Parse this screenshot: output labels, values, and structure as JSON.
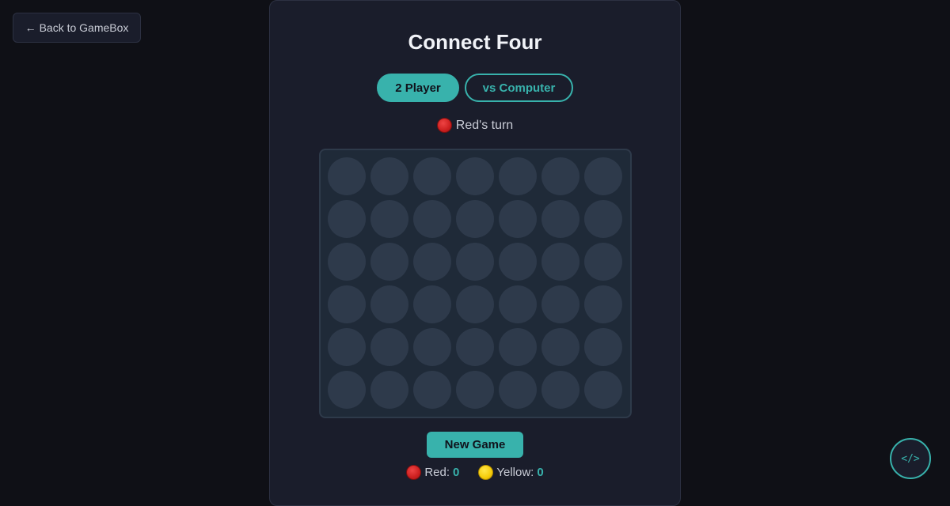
{
  "nav": {
    "back_arrow": "←",
    "back_label": "Back to GameBox"
  },
  "game": {
    "title": "Connect Four",
    "modes": [
      {
        "label": "2 Player",
        "active": true
      },
      {
        "label": "vs Computer",
        "active": false
      }
    ],
    "status_text": "Red's turn",
    "status_disc": "red",
    "board": {
      "rows": 6,
      "columns": 7,
      "cells": [
        [
          "",
          "",
          "",
          "",
          "",
          "",
          ""
        ],
        [
          "",
          "",
          "",
          "",
          "",
          "",
          ""
        ],
        [
          "",
          "",
          "",
          "",
          "",
          "",
          ""
        ],
        [
          "",
          "",
          "",
          "",
          "",
          "",
          ""
        ],
        [
          "",
          "",
          "",
          "",
          "",
          "",
          ""
        ],
        [
          "",
          "",
          "",
          "",
          "",
          "",
          ""
        ]
      ]
    },
    "new_game_label": "New Game",
    "scores": {
      "red_label": "Red:",
      "red_value": "0",
      "yellow_label": "Yellow:",
      "yellow_value": "0"
    }
  },
  "fab": {
    "code_label": "</>",
    "icon": "code-icon"
  },
  "colors": {
    "accent": "#38b2ac",
    "background": "#0f1016",
    "panel": "#1a1d2b",
    "board": "#1f2a38",
    "empty_slot": "#2e3a4b",
    "red_disc": "#cc1f1f",
    "yellow_disc": "#f5cc0a"
  }
}
